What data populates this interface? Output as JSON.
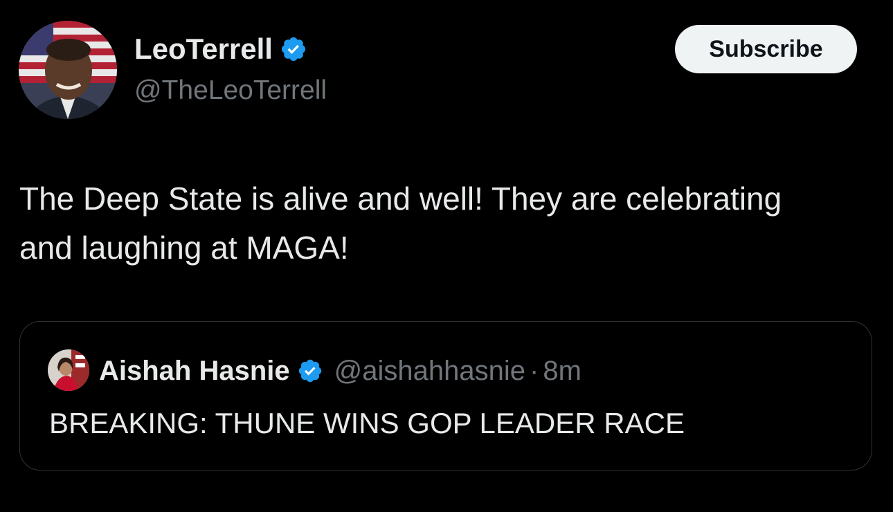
{
  "author": {
    "display_name": "LeoTerrell",
    "handle": "@TheLeoTerrell",
    "avatar_icon": "profile-photo",
    "verified_icon": "verified-badge-icon"
  },
  "subscribe_label": "Subscribe",
  "tweet": {
    "text": "The Deep State is alive and well! They are celebrating and laughing at MAGA!"
  },
  "quote": {
    "display_name": "Aishah Hasnie",
    "handle": "@aishahhasnie",
    "separator": "·",
    "time": "8m",
    "text": "BREAKING: THUNE WINS GOP LEADER RACE"
  },
  "colors": {
    "background": "#000000",
    "text": "#e7e9ea",
    "secondary": "#71767b",
    "verified": "#1d9bf0",
    "border": "#2f3336"
  }
}
